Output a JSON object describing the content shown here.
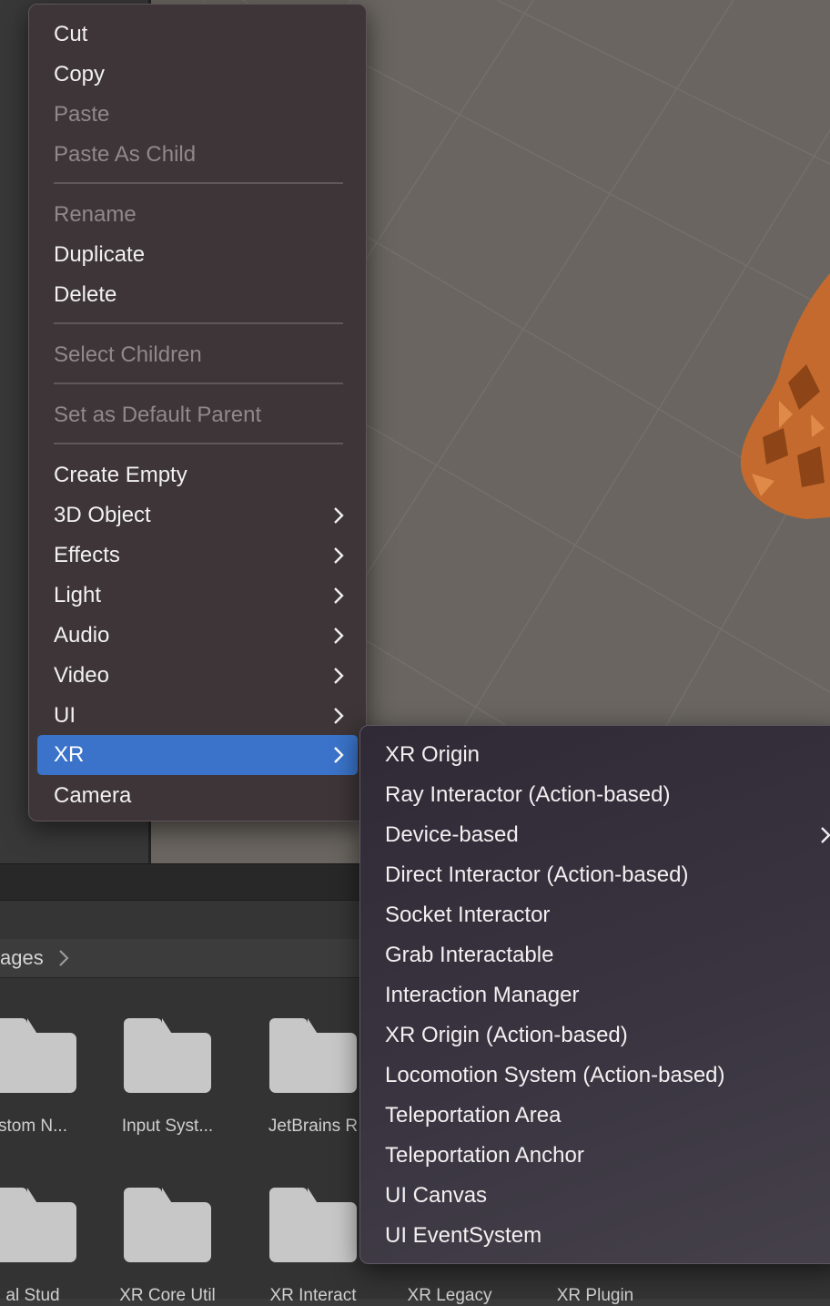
{
  "hierarchy_menu": {
    "items": [
      {
        "label": "Cut",
        "disabled": false
      },
      {
        "label": "Copy",
        "disabled": false
      },
      {
        "label": "Paste",
        "disabled": true
      },
      {
        "label": "Paste As Child",
        "disabled": true
      },
      {
        "label": "Rename",
        "disabled": true
      },
      {
        "label": "Duplicate",
        "disabled": false
      },
      {
        "label": "Delete",
        "disabled": false
      },
      {
        "label": "Select Children",
        "disabled": true
      },
      {
        "label": "Set as Default Parent",
        "disabled": true
      },
      {
        "label": "Create Empty",
        "disabled": false
      },
      {
        "label": "3D Object",
        "disabled": false,
        "submenu": true
      },
      {
        "label": "Effects",
        "disabled": false,
        "submenu": true
      },
      {
        "label": "Light",
        "disabled": false,
        "submenu": true
      },
      {
        "label": "Audio",
        "disabled": false,
        "submenu": true
      },
      {
        "label": "Video",
        "disabled": false,
        "submenu": true
      },
      {
        "label": "UI",
        "disabled": false,
        "submenu": true
      },
      {
        "label": "XR",
        "disabled": false,
        "submenu": true,
        "selected": true
      },
      {
        "label": "Camera",
        "disabled": false
      }
    ]
  },
  "xr_submenu": {
    "items": [
      {
        "label": "XR Origin"
      },
      {
        "label": "Ray Interactor (Action-based)"
      },
      {
        "label": "Device-based",
        "submenu": true
      },
      {
        "label": "Direct Interactor (Action-based)"
      },
      {
        "label": "Socket Interactor"
      },
      {
        "label": "Grab Interactable"
      },
      {
        "label": "Interaction Manager"
      },
      {
        "label": "XR Origin (Action-based)"
      },
      {
        "label": "Locomotion System (Action-based)"
      },
      {
        "label": "Teleportation Area"
      },
      {
        "label": "Teleportation Anchor"
      },
      {
        "label": "UI Canvas"
      },
      {
        "label": "UI EventSystem"
      }
    ]
  },
  "project": {
    "breadcrumb": "ages",
    "folders_row1": [
      "stom N...",
      "Input Syst...",
      "JetBrains R"
    ],
    "folders_row2": [
      "al Stud",
      "XR Core Util",
      "XR Interact",
      "XR Legacy",
      "XR Plugin"
    ]
  },
  "colors": {
    "menu_bg": "#3d3538",
    "selection": "#3a73c9",
    "disabled_text": "#8f898c",
    "scene_bg": "#6a6560",
    "model": "#c46a2e"
  },
  "icons": {
    "submenu_arrow": "chevron-right-icon",
    "folder": "folder-icon"
  }
}
